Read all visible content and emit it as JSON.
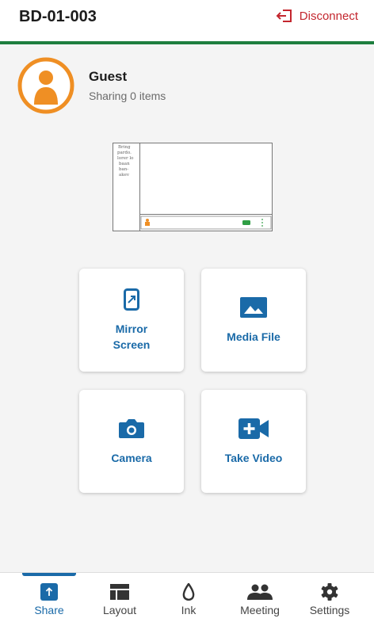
{
  "header": {
    "device_name": "BD-01-003",
    "disconnect_label": "Disconnect"
  },
  "user": {
    "name": "Guest",
    "status": "Sharing 0 items"
  },
  "preview": {
    "sidebar_text": [
      "Bring",
      "pardo.",
      "lorer lo",
      "baan",
      "ban-",
      "akev"
    ]
  },
  "share_options": [
    {
      "label": "Mirror\nScreen",
      "icon": "mirror-screen-icon"
    },
    {
      "label": "Media File",
      "icon": "image-icon"
    },
    {
      "label": "Camera",
      "icon": "camera-icon"
    },
    {
      "label": "Take Video",
      "icon": "video-add-icon"
    }
  ],
  "tabs": [
    {
      "label": "Share",
      "icon": "upload-icon",
      "active": true
    },
    {
      "label": "Layout",
      "icon": "layout-grid-icon",
      "active": false
    },
    {
      "label": "Ink",
      "icon": "ink-drop-icon",
      "active": false
    },
    {
      "label": "Meeting",
      "icon": "people-icon",
      "active": false
    },
    {
      "label": "Settings",
      "icon": "gear-icon",
      "active": false
    }
  ],
  "colors": {
    "accent": "#1a6aa8",
    "header_border": "#1e7e3e",
    "disconnect": "#c3262e",
    "avatar": "#ef8f24"
  }
}
